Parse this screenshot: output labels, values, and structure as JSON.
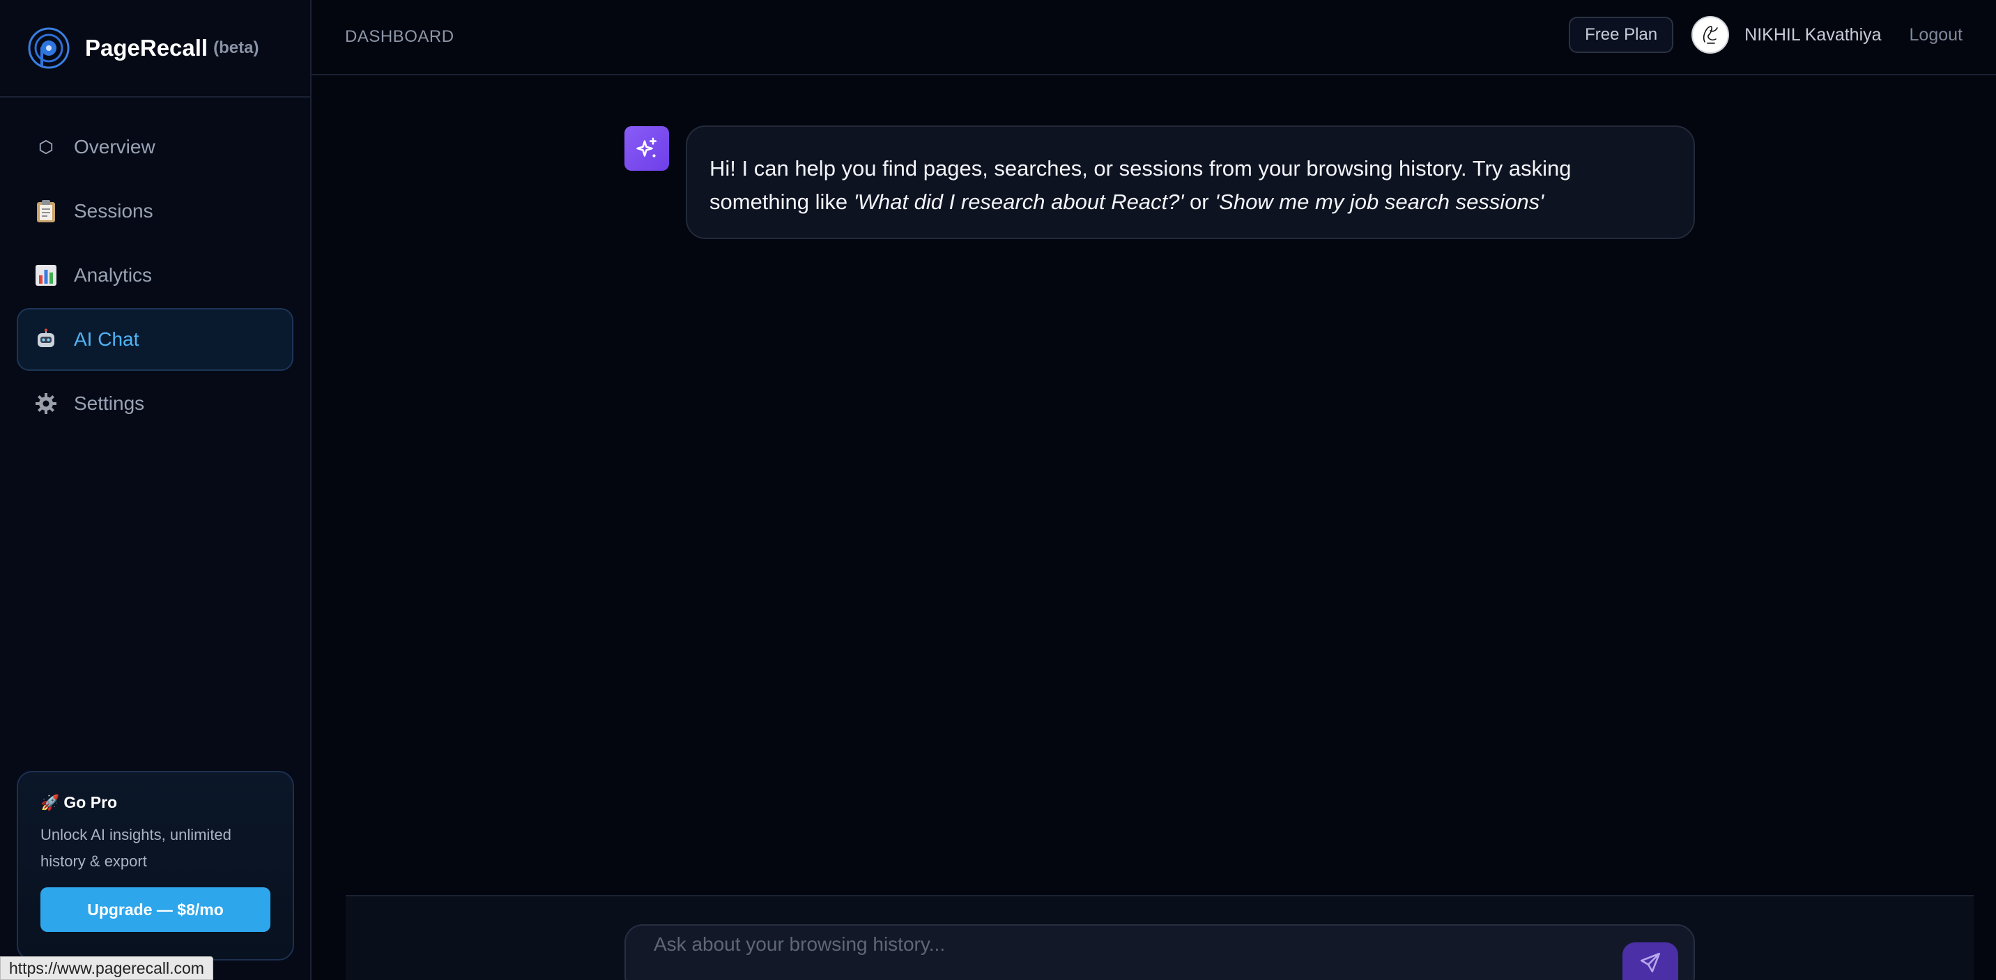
{
  "app": {
    "name": "PageRecall",
    "badge": "(beta)"
  },
  "sidebar": {
    "items": [
      {
        "label": "Overview",
        "icon": "hexagon-icon",
        "active": false
      },
      {
        "label": "Sessions",
        "icon": "clipboard-icon",
        "active": false
      },
      {
        "label": "Analytics",
        "icon": "bar-chart-icon",
        "active": false
      },
      {
        "label": "AI Chat",
        "icon": "robot-icon",
        "active": true
      },
      {
        "label": "Settings",
        "icon": "gear-icon",
        "active": false
      }
    ],
    "promo": {
      "title": "Go Pro",
      "description": "Unlock AI insights, unlimited history & export",
      "button_label": "Upgrade — $8/mo"
    }
  },
  "header": {
    "title": "DASHBOARD",
    "plan_badge": "Free Plan",
    "user_name": "NIKHIL Kavathiya",
    "logout_label": "Logout"
  },
  "chat": {
    "messages": [
      {
        "sender": "assistant",
        "text_intro": "Hi! I can help you find pages, searches, or sessions from your browsing history. Try asking something like ",
        "example_1": "'What did I research about React?'",
        "connector": " or ",
        "example_2": "'Show me my job search sessions'"
      }
    ],
    "input": {
      "placeholder": "Ask about your browsing history...",
      "value": ""
    }
  },
  "status_bar": {
    "url": "https://www.pagerecall.com"
  },
  "colors": {
    "accent": "#4fb3f6",
    "upgrade_button": "#2ea6ec",
    "assistant_avatar": "#7c4dff",
    "background": "#03060f"
  }
}
